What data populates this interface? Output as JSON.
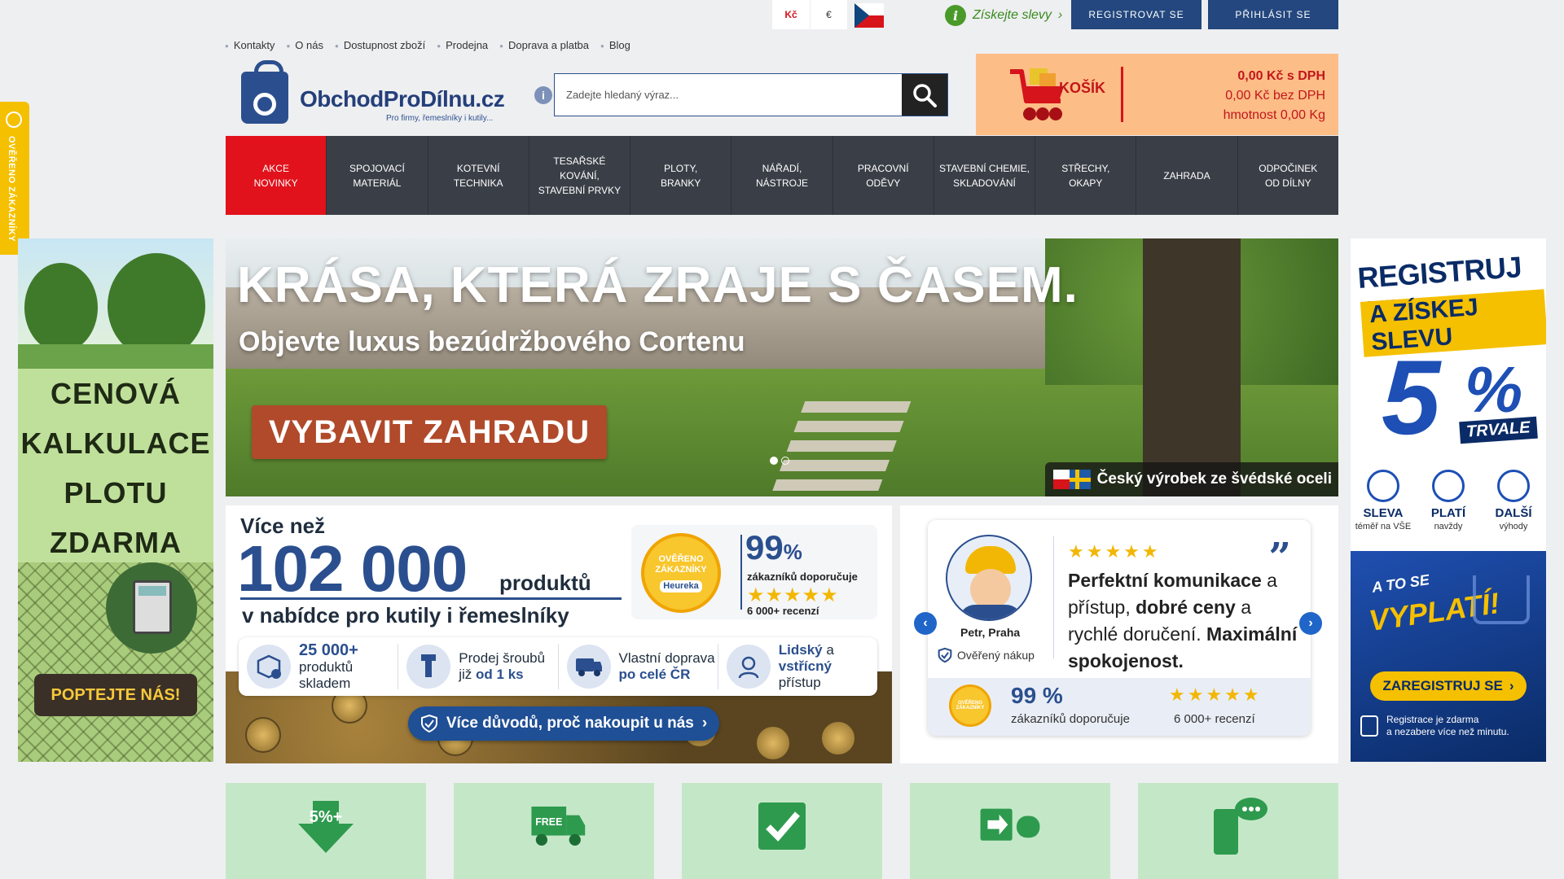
{
  "topbar": {
    "currencies": [
      "Kč",
      "€"
    ],
    "flag": "czech-flag",
    "discounts_label": "Získejte slevy",
    "register_label": "REGISTROVAT SE",
    "login_label": "PŘIHLÁSIT SE"
  },
  "toplinks": [
    "Kontakty",
    "O nás",
    "Dostupnost zboží",
    "Prodejna",
    "Doprava a platba",
    "Blog"
  ],
  "logo": {
    "name": "ObchodProDílnu.cz",
    "tagline": "Pro firmy, řemeslníky i kutily..."
  },
  "search": {
    "placeholder": "Zadejte hledaný výraz..."
  },
  "cart": {
    "label": "KOŠÍK",
    "price_vat": "0,00 Kč s DPH",
    "price_novat": "0,00 Kč bez DPH",
    "weight": "hmotnost 0,00 Kg"
  },
  "nav": [
    {
      "line1": "AKCE",
      "line2": "NOVINKY"
    },
    {
      "line1": "SPOJOVACÍ",
      "line2": "MATERIÁL"
    },
    {
      "line1": "KOTEVNÍ",
      "line2": "TECHNIKA"
    },
    {
      "line1": "TESAŘSKÉ KOVÁNÍ,",
      "line2": "STAVEBNÍ PRVKY"
    },
    {
      "line1": "PLOTY,",
      "line2": "BRANKY"
    },
    {
      "line1": "NÁŘADÍ,",
      "line2": "NÁSTROJE"
    },
    {
      "line1": "PRACOVNÍ",
      "line2": "ODĚVY"
    },
    {
      "line1": "STAVEBNÍ CHEMIE,",
      "line2": "SKLADOVÁNÍ"
    },
    {
      "line1": "STŘECHY,",
      "line2": "OKAPY"
    },
    {
      "line1": "ZAHRADA",
      "line2": ""
    },
    {
      "line1": "ODPOČINEK",
      "line2": "OD DÍLNY"
    }
  ],
  "verified_tab": "OVĚŘENO ZÁKAZNÍKY",
  "left_banner": {
    "lines": [
      "CENOVÁ",
      "KALKULACE",
      "PLOTU",
      "ZDARMA"
    ],
    "cta": "POPTEJTE NÁS!"
  },
  "hero": {
    "title": "KRÁSA, KTERÁ ZRAJE S ČASEM.",
    "subtitle": "Objevte luxus bezúdržbového Cortenu",
    "button": "VYBAVIT ZAHRADU",
    "badge": "Český výrobek ze švédské oceli"
  },
  "products": {
    "prefix": "Více než",
    "count": "102 000",
    "unit": "produktů",
    "subtitle": "v nabídce pro kutily i řemeslníky",
    "heureka": {
      "seal_line1": "OVĚŘENO",
      "seal_line2": "ZÁKAZNÍKY",
      "seal_brand": "Heureka",
      "percent": "99",
      "percent_sign": "%",
      "recommend": "zákazníků doporučuje",
      "stars": "★★★★★",
      "reviews": "6 000+ recenzí"
    },
    "features": [
      {
        "a": "25 000+",
        "b": "produktů",
        "c": "skladem"
      },
      {
        "a": "Prodej šroubů",
        "b": "již",
        "c": "od 1 ks"
      },
      {
        "a": "Vlastní doprava",
        "b": "po celé ČR",
        "c": ""
      },
      {
        "a": "Lidský",
        "b": "a",
        "c": "vstřícný",
        "d": "přístup"
      }
    ],
    "more": "Více důvodů, proč nakoupit u nás"
  },
  "review": {
    "stars": "★★★★★",
    "quote_mark": "”",
    "text_b1": "Perfektní komunikace",
    "text_1": "a přístup,",
    "text_b2": "dobré ceny",
    "text_2": "a rychlé doručení.",
    "text_b3": "Maximální spokojenost.",
    "author": "Petr, Praha",
    "verified": "Ověřený nákup",
    "percent": "99 %",
    "percent_label": "zákazníků doporučuje",
    "foot_stars": "★★★★★",
    "reviews": "6 000+ recenzí",
    "seal_text": "OVĚŘENO ZÁKAZNÍKY"
  },
  "right_banner": {
    "line1": "REGISTRUJ SE",
    "line2": "A ZÍSKEJ SLEVU",
    "five": "5",
    "percent": "%",
    "tag": "TRVALE",
    "perks": [
      {
        "title": "SLEVA",
        "sub": "téměř na VŠE"
      },
      {
        "title": "PLATÍ",
        "sub": "navždy"
      },
      {
        "title": "DALŠÍ",
        "sub": "výhody"
      }
    ],
    "ato": "A TO SE",
    "vyplati": "VYPLATÍ!",
    "button": "ZAREGISTRUJ SE",
    "note1": "Registrace je zdarma",
    "note2": "a nezabere více než minutu."
  },
  "bottom_boxes": [
    {
      "icon": "discount-arrow-icon",
      "text": "5%+"
    },
    {
      "icon": "free-truck-icon",
      "text": "FREE"
    },
    {
      "icon": "checkmark-icon",
      "text": ""
    },
    {
      "icon": "handshake-icon",
      "text": ""
    },
    {
      "icon": "phone-chat-icon",
      "text": ""
    }
  ],
  "colors": {
    "brand": "#2b4f8e",
    "nav_bg": "#3a3f47",
    "nav_active": "#e1121b",
    "cart_bg": "#fdbd86",
    "box_bg": "#c4e8c7",
    "accent_yellow": "#f5c000"
  }
}
